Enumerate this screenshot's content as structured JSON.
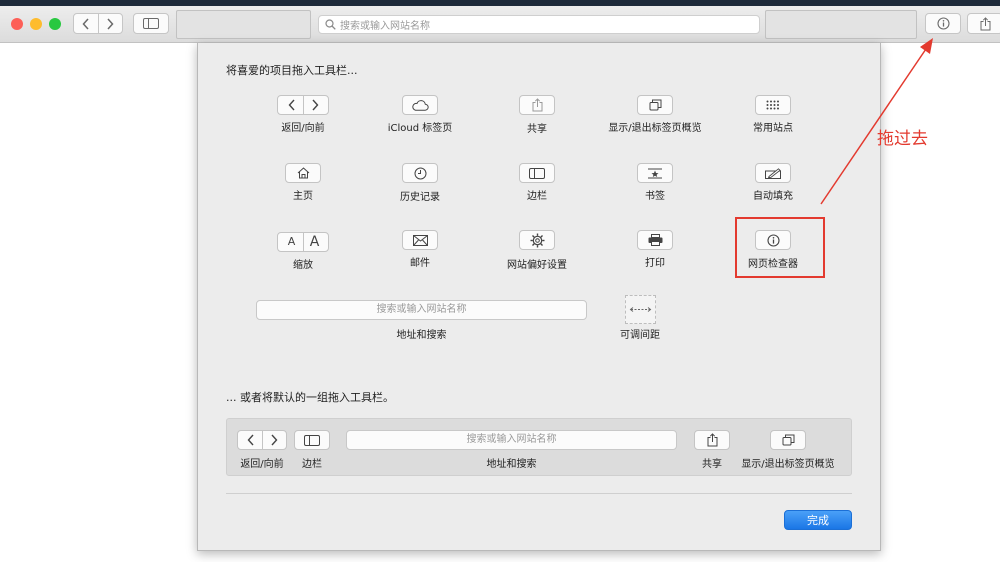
{
  "toolbar": {
    "url_placeholder": "搜索或输入网站名称",
    "icons": [
      "close-light",
      "minimize-light",
      "zoom-light",
      "back-icon",
      "forward-icon",
      "sidebar-icon",
      "search-icon",
      "info-icon",
      "share-icon"
    ],
    "lights": {
      "close": "#fd5f57",
      "minimize": "#febc2e",
      "zoom": "#28c840"
    }
  },
  "sheet": {
    "heading": "将喜爱的项目拖入工具栏...",
    "items": [
      {
        "label": "返回/向前",
        "icon": "back-forward-icon"
      },
      {
        "label": "iCloud 标签页",
        "icon": "cloud-icon"
      },
      {
        "label": "共享",
        "icon": "share-icon"
      },
      {
        "label": "显示/退出标签页概览",
        "icon": "tab-overview-icon"
      },
      {
        "label": "常用站点",
        "icon": "grid-icon"
      },
      {
        "label": "主页",
        "icon": "home-icon"
      },
      {
        "label": "历史记录",
        "icon": "clock-icon"
      },
      {
        "label": "边栏",
        "icon": "sidebar-icon"
      },
      {
        "label": "书签",
        "icon": "bookmark-icon"
      },
      {
        "label": "自动填充",
        "icon": "autofill-icon"
      },
      {
        "label": "缩放",
        "icon": "zoom-text-icon"
      },
      {
        "label": "邮件",
        "icon": "mail-icon"
      },
      {
        "label": "网站偏好设置",
        "icon": "gear-icon"
      },
      {
        "label": "打印",
        "icon": "printer-icon"
      },
      {
        "label": "网页检查器",
        "icon": "info-icon"
      }
    ],
    "zoom_glyphs": {
      "small": "A",
      "large": "A"
    },
    "search_field": {
      "placeholder": "搜索或输入网站名称",
      "label": "地址和搜索"
    },
    "flexible_space_label": "可调间距",
    "default_heading": "... 或者将默认的一组拖入工具栏。",
    "default_set": {
      "back_forward_label": "返回/向前",
      "sidebar_label": "边栏",
      "search_placeholder": "搜索或输入网站名称",
      "search_label": "地址和搜索",
      "share_label": "共享",
      "tab_overview_label": "显示/退出标签页概览"
    },
    "done_button": "完成"
  },
  "annotation": {
    "text": "拖过去",
    "color": "#e33a2f"
  }
}
